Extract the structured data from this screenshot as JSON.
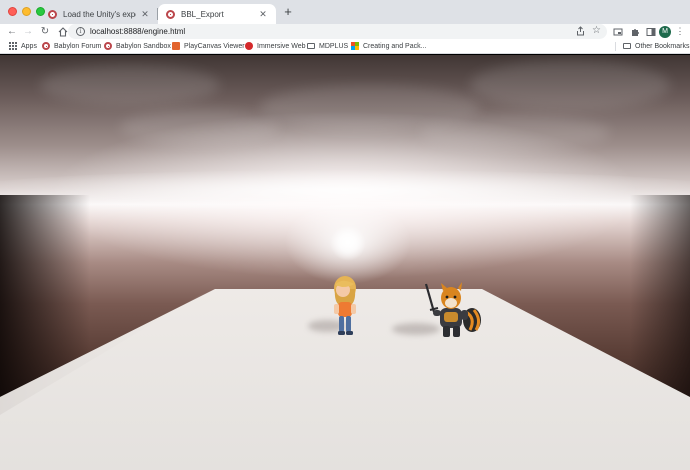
{
  "window": {
    "traffic_lights": [
      "close",
      "minimize",
      "maximize"
    ]
  },
  "tabs": [
    {
      "title": "Load the Unity's exported sce",
      "active": false,
      "favicon": "babylon-logo-icon"
    },
    {
      "title": "BBL_Export",
      "active": true,
      "favicon": "babylon-logo-icon"
    }
  ],
  "toolbar": {
    "url": "localhost:8888/engine.html",
    "avatar_initial": "M"
  },
  "bookmarks": {
    "items": [
      {
        "label": "Apps",
        "icon": "apps-grid-icon"
      },
      {
        "label": "Babylon Forum",
        "icon": "babylon-logo-icon"
      },
      {
        "label": "Babylon Sandbox",
        "icon": "babylon-logo-icon"
      },
      {
        "label": "PlayCanvas Viewer",
        "icon": "playcanvas-icon"
      },
      {
        "label": "Immersive Web",
        "icon": "immersive-web-icon"
      },
      {
        "label": "MDPLUS",
        "icon": "folder-icon"
      },
      {
        "label": "Creating and Pack...",
        "icon": "microsoft-icon"
      }
    ],
    "other": "Other Bookmarks"
  },
  "scene": {
    "sky": "cloudy skybox",
    "characters": [
      "girl-character",
      "fox-knight-character"
    ]
  },
  "colors": {
    "tab_strip": "#dee1e6",
    "babylon_brand": "#bb464b",
    "ground": "#e8e5e2"
  }
}
